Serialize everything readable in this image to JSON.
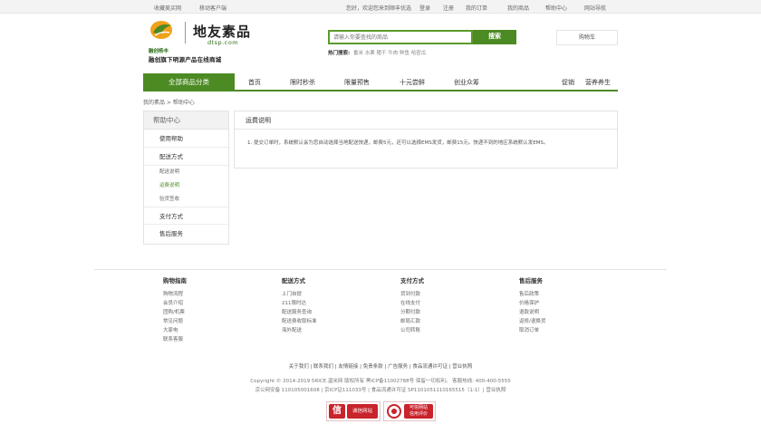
{
  "topbar": {
    "left": [
      "收藏美买网",
      "移动客户端"
    ],
    "welcome": "您好，欢迎您来到顺丰优选",
    "login": "登录",
    "register": "注册",
    "my_orders": "我的订单",
    "my_account": "我的商品",
    "help_center": "帮助中心",
    "site_nav": "网站导航"
  },
  "logo": {
    "brand_sub": "融创杨丰",
    "script": "地友素品",
    "domain": "dtsp.com",
    "slogan": "融创旗下明源产品在线商城"
  },
  "search": {
    "placeholder": "请输入你要查找的商品",
    "button": "搜索",
    "hot_label": "热门搜索:",
    "hot_keywords": [
      "番米",
      "水果",
      "猪干",
      "牛肉",
      "鲜鱼",
      "哈密瓜"
    ]
  },
  "cart": {
    "label": "购物车"
  },
  "nav": {
    "all": "全部商品分类",
    "items": [
      "首页",
      "限时秒杀",
      "限量预售",
      "十元尝鲜",
      "创业众筹"
    ],
    "right": [
      "促销",
      "营养养生"
    ]
  },
  "breadcrumb": "我的素品 > 帮助中心",
  "sidebar": {
    "title": "帮助中心",
    "g1": "使用帮助",
    "g2": "配送方式",
    "sub": [
      "配送说明",
      "运费说明",
      "验货签收"
    ],
    "g3": "支付方式",
    "g4": "售后服务"
  },
  "content": {
    "title": "运费说明",
    "body": "1. 提交订单时，系统默认会为您自动选择当地配送快递，邮费5元，还可以选择EMS发货，邮费15元。快递不到的地区系统默认发EMS。"
  },
  "footer": {
    "cols": [
      {
        "title": "购物指南",
        "items": [
          "购物流程",
          "会员介绍",
          "团购/机票",
          "常见问题",
          "大家电",
          "联系客服"
        ]
      },
      {
        "title": "配送方式",
        "items": [
          "上门自提",
          "211限时达",
          "配送服务查询",
          "配送费收取标准",
          "海外配送"
        ]
      },
      {
        "title": "支付方式",
        "items": [
          "货到付款",
          "在线支付",
          "分期付款",
          "邮局汇款",
          "公司转账"
        ]
      },
      {
        "title": "售后服务",
        "items": [
          "售后政策",
          "价格保护",
          "退款说明",
          "返修/退换货",
          "取消订单"
        ]
      }
    ],
    "links": "关于我们 | 联系我们 | 友情链接 | 免责条款 | 广告服务 | 食品流通许可证 | 营业执照",
    "copyright1": "Copyright © 2014-2019 5RICE.温米网 版权所有 黑ICP备11002788号 保留一切权利。 客服热线: 400-400-5555",
    "copyright2": "京公网安备 110105001608 | 京ICP证111033号 | 食品流通许可证 SP1101051110165515（1-1）| 营业执照"
  },
  "badges": {
    "b1_mark": "信",
    "b1_text": "诚信网站",
    "b2_text_1": "可信网站",
    "b2_text_2": "信用评价"
  },
  "colors": {
    "accent": "#4c8a23",
    "badge": "#c9232b"
  }
}
